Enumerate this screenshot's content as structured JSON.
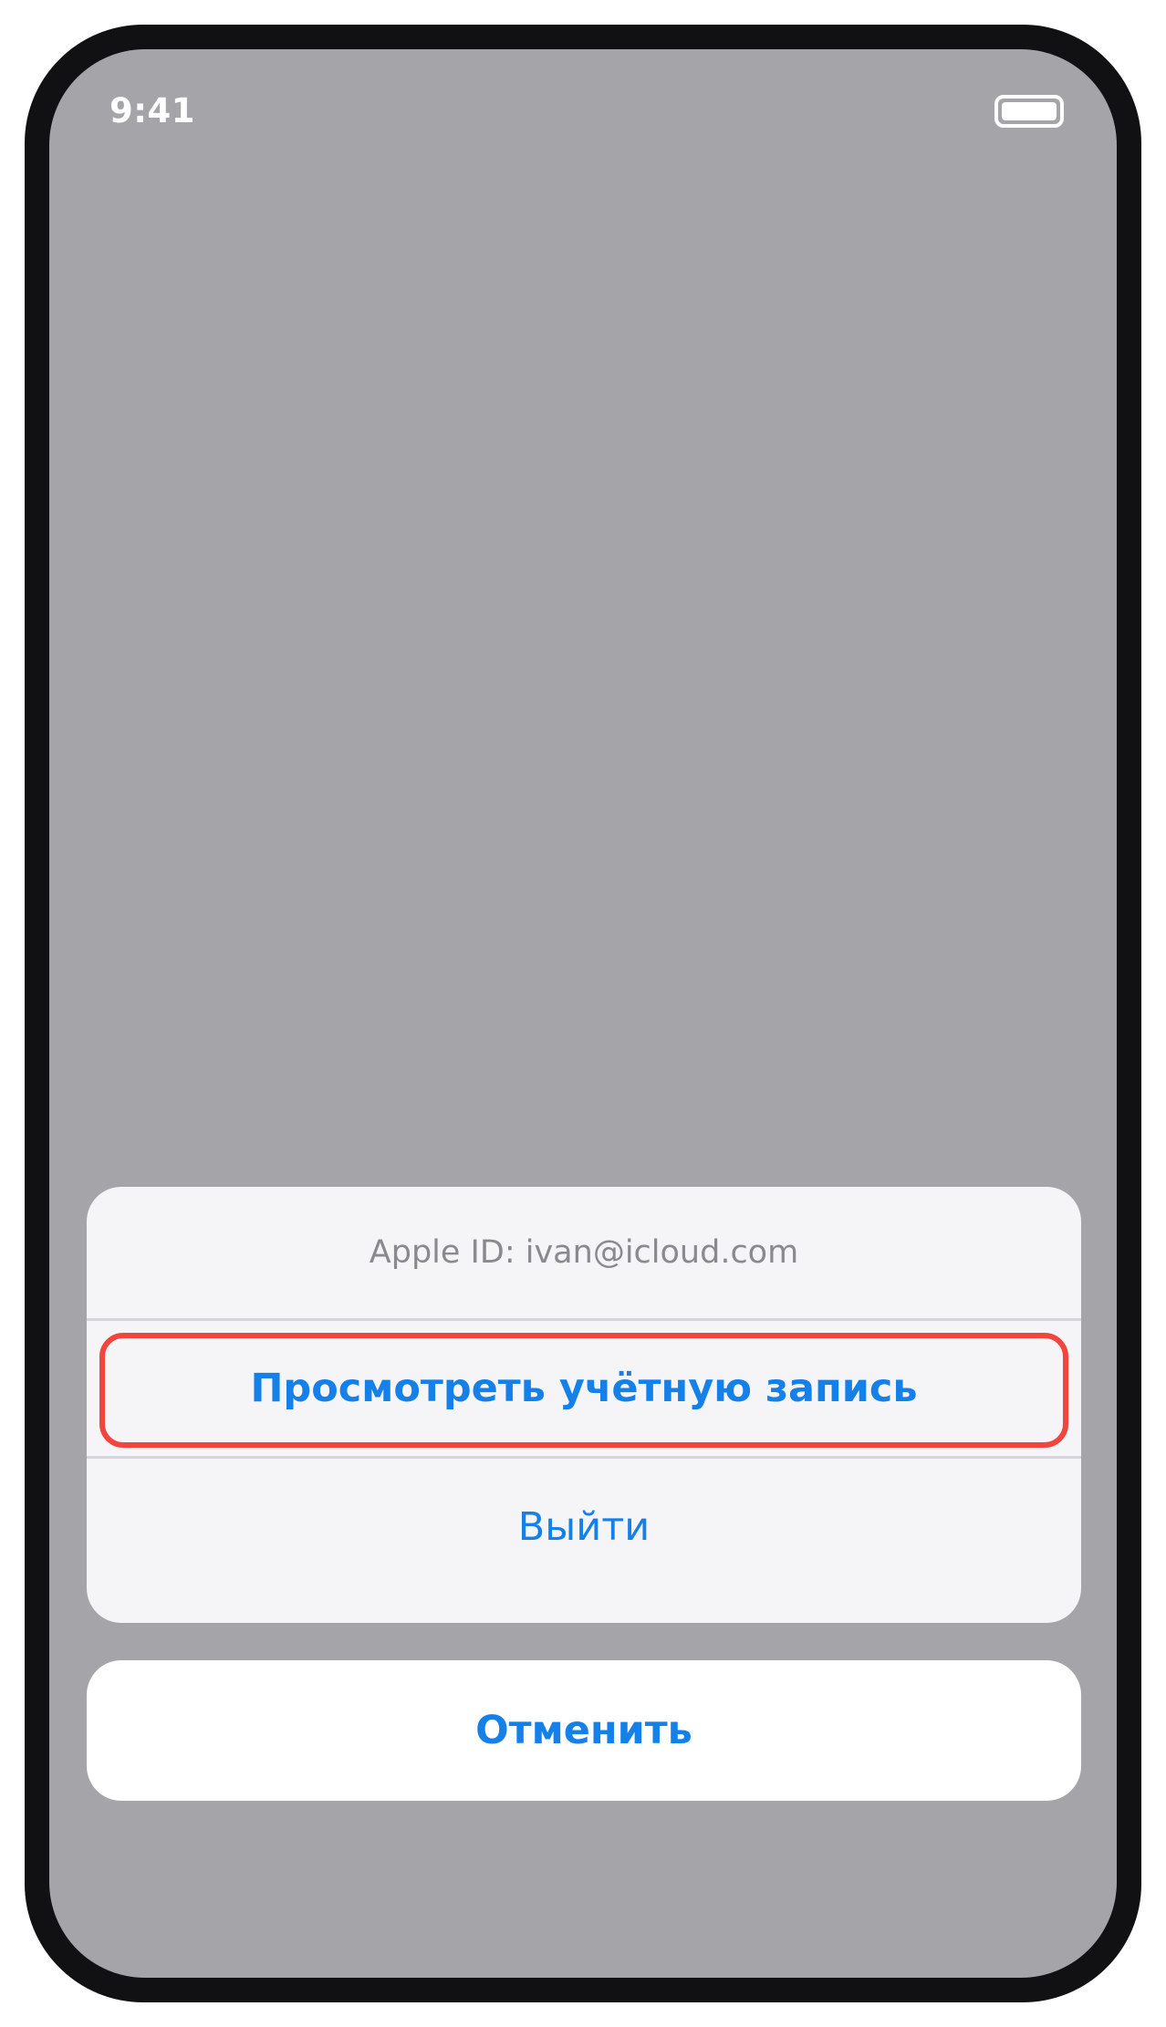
{
  "status_bar": {
    "time": "9:41",
    "battery_icon": "battery-full-icon"
  },
  "action_sheet": {
    "header": "Apple ID: ivan@icloud.com",
    "view_account_label": "Просмотреть учётную запись",
    "sign_out_label": "Выйти"
  },
  "cancel_label": "Отменить",
  "colors": {
    "accent": "#1580e8",
    "highlight": "#f2453d",
    "dim_background": "#a5a4a8",
    "sheet_background": "#f5f5f8"
  }
}
